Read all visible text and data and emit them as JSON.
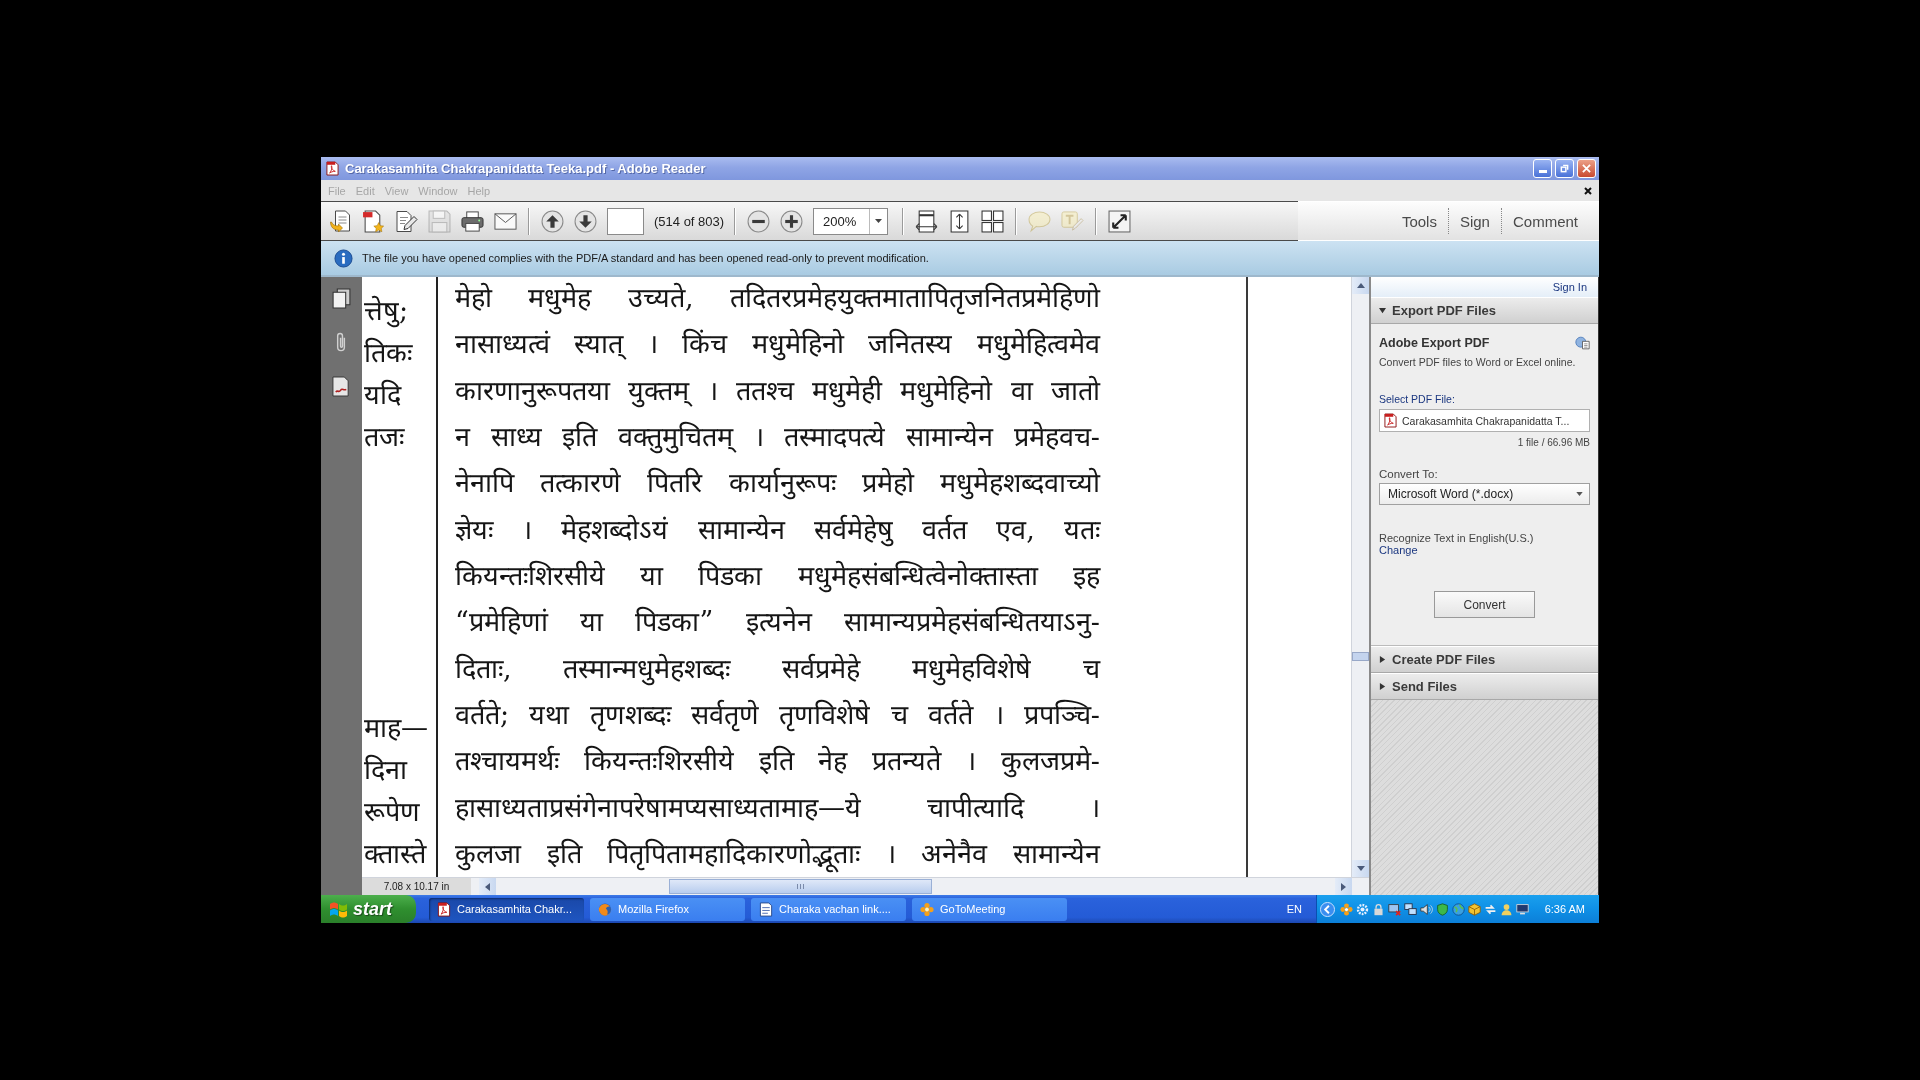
{
  "window": {
    "title": "Carakasamhita Chakrapanidatta Teeka.pdf - Adobe Reader"
  },
  "menu": [
    {
      "label": "File"
    },
    {
      "label": "Edit"
    },
    {
      "label": "View"
    },
    {
      "label": "Window"
    },
    {
      "label": "Help"
    }
  ],
  "toolbar": {
    "file_tools": [
      {
        "kind": "open",
        "disabled": false
      },
      {
        "kind": "create",
        "disabled": false
      },
      {
        "kind": "edit",
        "disabled": false
      },
      {
        "kind": "save",
        "disabled": true
      },
      {
        "kind": "print",
        "disabled": false
      },
      {
        "kind": "email",
        "disabled": false
      }
    ],
    "page_tools": [
      {
        "kind": "previous",
        "disabled": false
      },
      {
        "kind": "next",
        "disabled": false
      }
    ],
    "page_status": "(514 of 803)",
    "zoom_tools": [
      {
        "kind": "zoom_out",
        "disabled": false
      },
      {
        "kind": "zoom_in",
        "disabled": false
      }
    ],
    "zoom_value": "200%",
    "view_tools": [
      {
        "kind": "fit_width",
        "disabled": false
      },
      {
        "kind": "fit_page",
        "disabled": false
      },
      {
        "kind": "spread",
        "disabled": false
      }
    ],
    "comment_tools": [
      {
        "kind": "note",
        "disabled": true
      },
      {
        "kind": "highlight",
        "disabled": true
      }
    ],
    "screen_tools": [
      {
        "kind": "full_screen",
        "disabled": false
      }
    ],
    "panes": [
      {
        "label": "Tools",
        "selected": false
      },
      {
        "label": "Sign",
        "selected": false
      },
      {
        "label": "Comment",
        "selected": false
      }
    ]
  },
  "info_bar": {
    "message": "The file you have opened complies with the PDF/A standard and has been opened read-only to prevent modification."
  },
  "document": {
    "margin_blocks": [
      [
        "त्तेषु;",
        "तिकः",
        "यदि",
        "तजः"
      ],
      [
        "माह—",
        "दिना",
        "रूपेण",
        "क्तास्ते"
      ]
    ],
    "lines": [
      "मेहो मधुमेह उच्यते, तदितरप्रमेहयुक्तमातापितृजनितप्रमेहिणो",
      "नासाध्यत्वं स्यात् । किंच मधुमेहिनो जनितस्य मधुमेहित्वमेव",
      "कारणानुरूपतया युक्तम् । ततश्च मधुमेही मधुमेहिनो वा जातो",
      "न साध्य इति वक्तुमुचितम् । तस्मादपत्ये सामान्येन प्रमेहवच-",
      "नेनापि तत्कारणे पितरि कार्यानुरूपः प्रमेहो मधुमेहशब्दवाच्यो",
      "ज्ञेयः । मेहशब्दोऽयं सामान्येन सर्वमेहेषु वर्तत एव, यतः",
      "कियन्तःशिरसीये या पिडका मधुमेहसंबन्धित्वेनोक्तास्ता इह",
      "“प्रमेहिणां या पिडका” इत्यनेन सामान्यप्रमेहसंबन्धितयाऽनु-",
      "दिताः, तस्मान्मधुमेहशब्दः सर्वप्रमेहे मधुमेहविशेषे च",
      "वर्तते; यथा तृणशब्दः सर्वतृणे तृणविशेषे च वर्तते । प्रपञ्चि-",
      "तश्चायमर्थः कियन्तःशिरसीये इति नेह प्रतन्यते । कुलजप्रमे-",
      "हासाध्यताप्रसंगेनापरेषामप्यसाध्यतामाह—ये चापीत्यादि ।",
      "कुलजा इति पितृपितामहादिकारणोद्भूताः । अनेनैव सामान्येन"
    ],
    "page_size": "7.08 x 10.17 in"
  },
  "side_panel": {
    "sign_in": "Sign In",
    "sections": [
      {
        "title": "Export PDF Files",
        "expanded": true,
        "content": {
          "heading": "Adobe Export PDF",
          "description": "Convert PDF files to Word or Excel online.",
          "file_label": "Select PDF File:",
          "file_name": "Carakasamhita Chakrapanidatta T...",
          "file_info": "1 file / 66.96 MB",
          "convert_label": "Convert To:",
          "format": "Microsoft Word (*.docx)",
          "ocr_note": "Recognize Text in English(U.S.)",
          "change_link": "Change",
          "convert_button": "Convert"
        }
      },
      {
        "title": "Create PDF Files",
        "expanded": false
      },
      {
        "title": "Send Files",
        "expanded": false
      }
    ]
  },
  "taskbar": {
    "start": "start",
    "tasks": [
      {
        "label": "Carakasamhita Chakr...",
        "kind": "pdf",
        "selected": true
      },
      {
        "label": "Mozilla Firefox",
        "kind": "browser",
        "selected": false
      },
      {
        "label": "Charaka vachan link....",
        "kind": "document",
        "selected": false
      },
      {
        "label": "GoToMeeting",
        "kind": "meeting",
        "selected": false
      }
    ],
    "language": "EN",
    "clock": "6:36 AM"
  }
}
